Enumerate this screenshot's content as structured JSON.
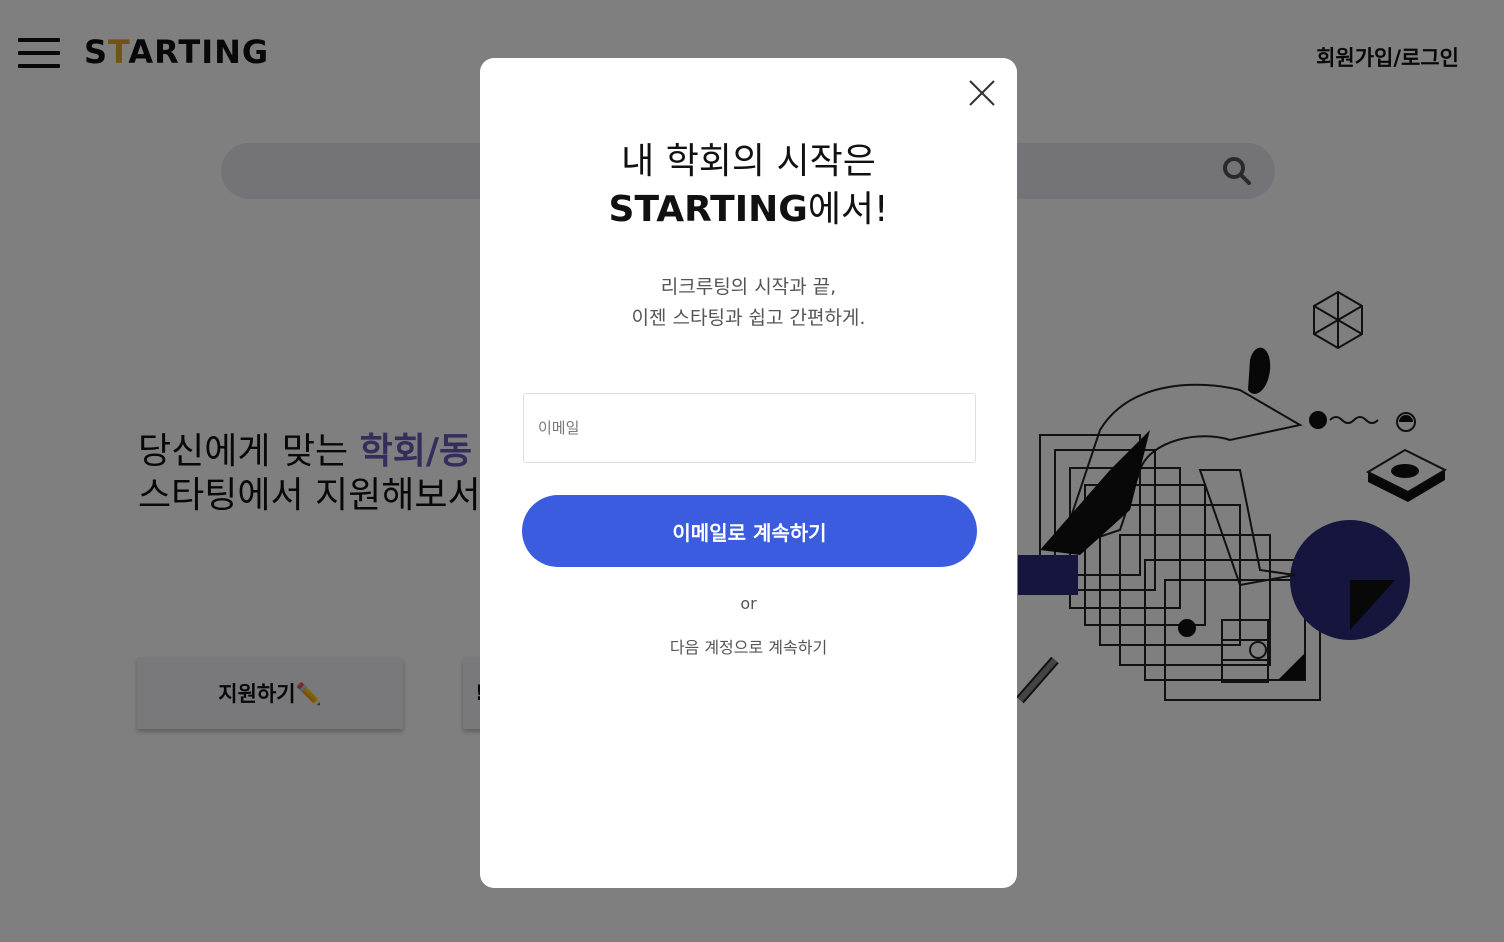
{
  "header": {
    "logo_pre": "S",
    "logo_accent": "T",
    "logo_post": "ARTING",
    "auth_link": "회원가입/로그인"
  },
  "hero": {
    "line1_pre": "당신에게 맞는 ",
    "line1_highlight": "학회/동",
    "line2": "스타팅에서 지원해보서",
    "apply_button": "지원하기✏️",
    "second_button": "!"
  },
  "modal": {
    "title_line1": "내 학회의 시작은",
    "title_brand": "STARTING",
    "title_suffix": "에서!",
    "subtitle_line1": "리크루팅의 시작과 끝,",
    "subtitle_line2": "이젠 스타팅과 쉽고 간편하게.",
    "email_placeholder": "이메일",
    "continue_button": "이메일로 계속하기",
    "or_text": "or",
    "other_accounts": "다음 계정으로 계속하기"
  },
  "colors": {
    "accent": "#e2a82a",
    "primary": "#3c5ce0",
    "highlight": "#6b5db8"
  }
}
